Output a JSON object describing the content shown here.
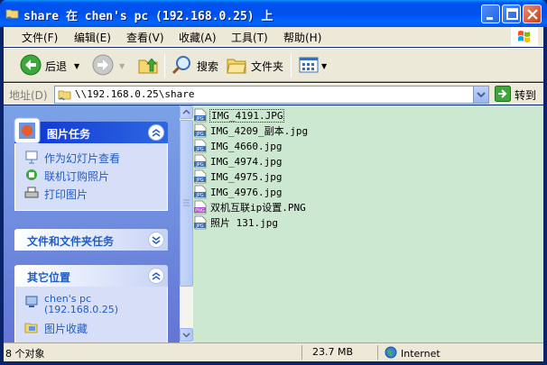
{
  "window": {
    "title": "share 在 chen's pc (192.168.0.25) 上"
  },
  "menu": [
    {
      "label": "文件(F)"
    },
    {
      "label": "编辑(E)"
    },
    {
      "label": "查看(V)"
    },
    {
      "label": "收藏(A)"
    },
    {
      "label": "工具(T)"
    },
    {
      "label": "帮助(H)"
    }
  ],
  "toolbar": {
    "back_label": "后退",
    "search_label": "搜索",
    "folders_label": "文件夹"
  },
  "address": {
    "label": "地址(D)",
    "value": "\\\\192.168.0.25\\share",
    "go_label": "转到"
  },
  "tasks": {
    "picture_tasks": {
      "title": "图片任务",
      "links": [
        {
          "label": "作为幻灯片查看",
          "icon": "slideshow-icon"
        },
        {
          "label": "联机订购照片",
          "icon": "order-photos-icon"
        },
        {
          "label": "打印图片",
          "icon": "print-icon"
        }
      ]
    },
    "file_tasks": {
      "title": "文件和文件夹任务"
    },
    "other_places": {
      "title": "其它位置",
      "links": [
        {
          "label": "chen's pc",
          "sub": "(192.168.0.25)",
          "icon": "network-computer-icon"
        },
        {
          "label": "图片收藏",
          "icon": "my-pictures-icon"
        }
      ]
    }
  },
  "files": [
    {
      "name": "IMG_4191.JPG",
      "type": "jpg",
      "selected": true
    },
    {
      "name": "IMG_4209_副本.jpg",
      "type": "jpg"
    },
    {
      "name": "IMG_4660.jpg",
      "type": "jpg"
    },
    {
      "name": "IMG_4974.jpg",
      "type": "jpg"
    },
    {
      "name": "IMG_4975.jpg",
      "type": "jpg"
    },
    {
      "name": "IMG_4976.jpg",
      "type": "jpg"
    },
    {
      "name": "双机互联ip设置.PNG",
      "type": "png"
    },
    {
      "name": "照片 131.jpg",
      "type": "jpg"
    }
  ],
  "status": {
    "objects": "8 个对象",
    "size": "23.7 MB",
    "zone": "Internet"
  },
  "colors": {
    "titlebar": "#0053ee",
    "file_pane": "#cde8d0",
    "task_pane": "#7ba2e7"
  }
}
